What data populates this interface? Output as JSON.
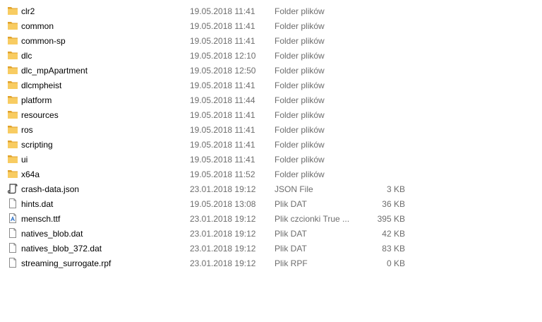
{
  "files": [
    {
      "name": "clr2",
      "date": "19.05.2018 11:41",
      "type": "Folder plików",
      "size": "",
      "icon": "folder-icon"
    },
    {
      "name": "common",
      "date": "19.05.2018 11:41",
      "type": "Folder plików",
      "size": "",
      "icon": "folder-icon"
    },
    {
      "name": "common-sp",
      "date": "19.05.2018 11:41",
      "type": "Folder plików",
      "size": "",
      "icon": "folder-icon"
    },
    {
      "name": "dlc",
      "date": "19.05.2018 12:10",
      "type": "Folder plików",
      "size": "",
      "icon": "folder-icon"
    },
    {
      "name": "dlc_mpApartment",
      "date": "19.05.2018 12:50",
      "type": "Folder plików",
      "size": "",
      "icon": "folder-icon"
    },
    {
      "name": "dlcmpheist",
      "date": "19.05.2018 11:41",
      "type": "Folder plików",
      "size": "",
      "icon": "folder-icon"
    },
    {
      "name": "platform",
      "date": "19.05.2018 11:44",
      "type": "Folder plików",
      "size": "",
      "icon": "folder-icon"
    },
    {
      "name": "resources",
      "date": "19.05.2018 11:41",
      "type": "Folder plików",
      "size": "",
      "icon": "folder-icon"
    },
    {
      "name": "ros",
      "date": "19.05.2018 11:41",
      "type": "Folder plików",
      "size": "",
      "icon": "folder-icon"
    },
    {
      "name": "scripting",
      "date": "19.05.2018 11:41",
      "type": "Folder plików",
      "size": "",
      "icon": "folder-icon"
    },
    {
      "name": "ui",
      "date": "19.05.2018 11:41",
      "type": "Folder plików",
      "size": "",
      "icon": "folder-icon"
    },
    {
      "name": "x64a",
      "date": "19.05.2018 11:52",
      "type": "Folder plików",
      "size": "",
      "icon": "folder-icon"
    },
    {
      "name": "crash-data.json",
      "date": "23.01.2018 19:12",
      "type": "JSON File",
      "size": "3 KB",
      "icon": "json-file-icon"
    },
    {
      "name": "hints.dat",
      "date": "19.05.2018 13:08",
      "type": "Plik DAT",
      "size": "36 KB",
      "icon": "file-icon"
    },
    {
      "name": "mensch.ttf",
      "date": "23.01.2018 19:12",
      "type": "Plik czcionki True ...",
      "size": "395 KB",
      "icon": "font-file-icon"
    },
    {
      "name": "natives_blob.dat",
      "date": "23.01.2018 19:12",
      "type": "Plik DAT",
      "size": "42 KB",
      "icon": "file-icon"
    },
    {
      "name": "natives_blob_372.dat",
      "date": "23.01.2018 19:12",
      "type": "Plik DAT",
      "size": "83 KB",
      "icon": "file-icon"
    },
    {
      "name": "streaming_surrogate.rpf",
      "date": "23.01.2018 19:12",
      "type": "Plik RPF",
      "size": "0 KB",
      "icon": "file-icon"
    }
  ],
  "colors": {
    "folder": "#f6c453",
    "folder_dark": "#e0a22b",
    "meta_text": "#6d6d6d",
    "hover": "#e5f3ff"
  }
}
